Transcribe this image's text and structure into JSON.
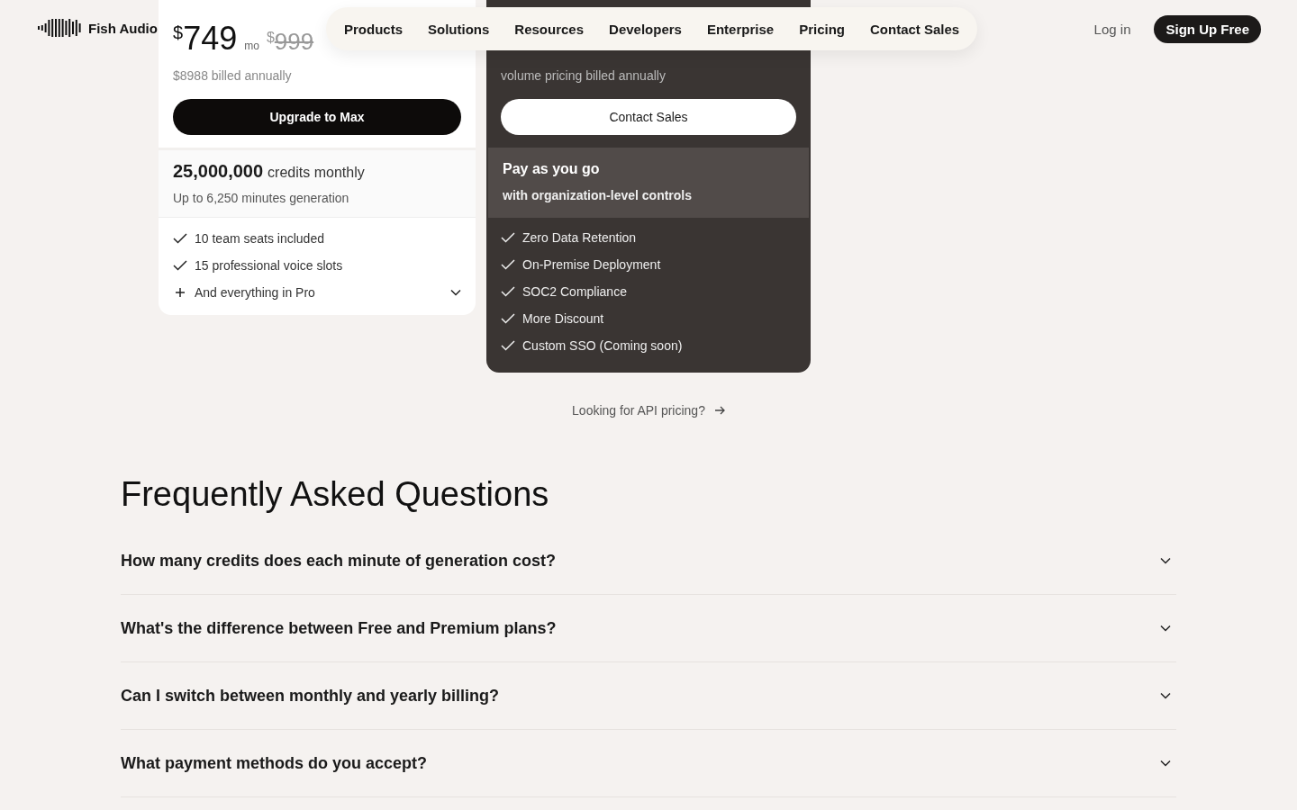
{
  "nav": {
    "brand": "Fish Audio",
    "links": [
      "Products",
      "Solutions",
      "Resources",
      "Developers",
      "Enterprise",
      "Pricing",
      "Contact Sales"
    ],
    "login": "Log in",
    "signup": "Sign Up Free"
  },
  "plans": [
    {
      "kind": "light",
      "currency": "$",
      "price": "749",
      "period": "mo",
      "old_currency": "$",
      "old_price": "999",
      "billing": "$8988 billed annually",
      "button": "Upgrade to Max",
      "credits_amount": "25,000,000",
      "credits_label": "credits monthly",
      "credits_note": "Up to 6,250 minutes generation",
      "features": [
        {
          "kind": "check",
          "text": "10 team seats included"
        },
        {
          "kind": "check",
          "text": "15 professional voice slots"
        },
        {
          "kind": "more",
          "text": "And everything in Pro",
          "expanded": false
        }
      ]
    },
    {
      "kind": "dark",
      "billing": "volume pricing billed annually",
      "button": "Contact Sales",
      "highlight_title": "Pay as you go",
      "highlight_note": "with organization-level controls",
      "features": [
        {
          "kind": "check",
          "text": "Zero Data Retention"
        },
        {
          "kind": "check",
          "text": "On-Premise Deployment"
        },
        {
          "kind": "check",
          "text": "SOC2 Compliance"
        },
        {
          "kind": "check",
          "text": "More Discount"
        },
        {
          "kind": "check",
          "text": "Custom SSO (Coming soon)"
        }
      ]
    }
  ],
  "api_link": "Looking for API pricing?",
  "faq": {
    "title": "Frequently Asked Questions",
    "items": [
      {
        "question": "How many credits does each minute of generation cost?",
        "expanded": false
      },
      {
        "question": "What's the difference between Free and Premium plans?",
        "expanded": false
      },
      {
        "question": "Can I switch between monthly and yearly billing?",
        "expanded": false
      },
      {
        "question": "What payment methods do you accept?",
        "expanded": false
      }
    ]
  }
}
